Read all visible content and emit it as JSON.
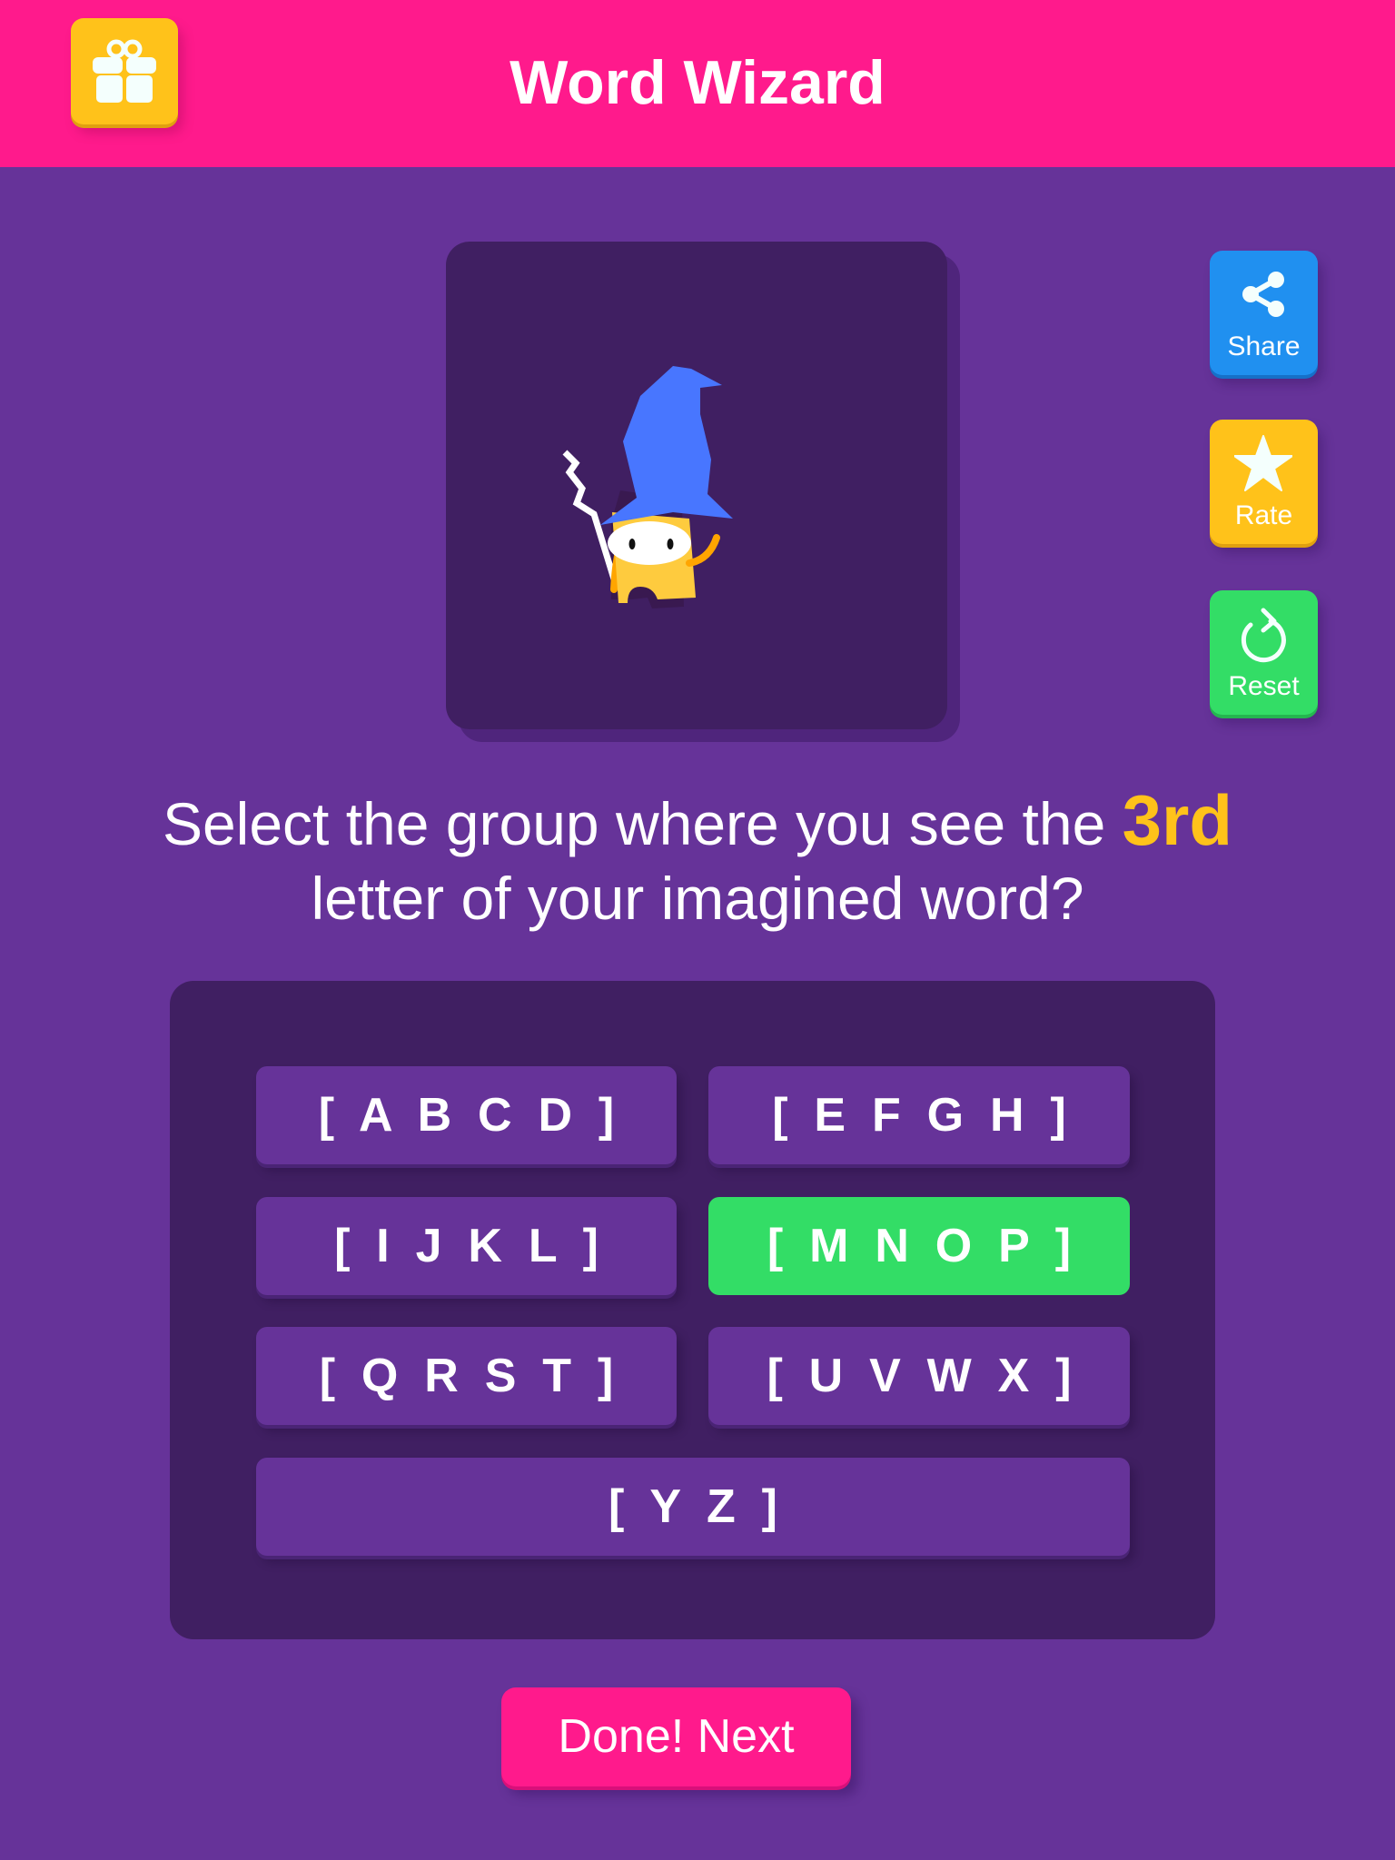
{
  "header": {
    "title": "Word Wizard",
    "gift_icon": "gift-icon"
  },
  "colors": {
    "header_bg": "#FF1A8C",
    "page_bg": "#663399",
    "panel_bg": "#401F62",
    "highlight": "#FFC21A",
    "selected": "#33DD66",
    "share": "#2090F0",
    "rate": "#FFC21A",
    "reset": "#33DD66"
  },
  "mascot": {
    "description": "wizard character with blue hat and staff"
  },
  "side_buttons": [
    {
      "label": "Share",
      "icon": "share-icon"
    },
    {
      "label": "Rate",
      "icon": "star-icon"
    },
    {
      "label": "Reset",
      "icon": "refresh-icon"
    }
  ],
  "question": {
    "prefix": "Select the group where you see the ",
    "highlight": "3rd",
    "suffix": "letter of your imagined word?"
  },
  "groups": [
    {
      "label": "[ A B C D ]",
      "selected": false
    },
    {
      "label": "[ E F G H ]",
      "selected": false
    },
    {
      "label": "[ I J K L ]",
      "selected": false
    },
    {
      "label": "[ M N O P ]",
      "selected": true
    },
    {
      "label": "[ Q R S T ]",
      "selected": false
    },
    {
      "label": "[ U V W X ]",
      "selected": false
    },
    {
      "label": "[ Y Z ]",
      "selected": false
    }
  ],
  "done_button": {
    "label": "Done! Next"
  }
}
